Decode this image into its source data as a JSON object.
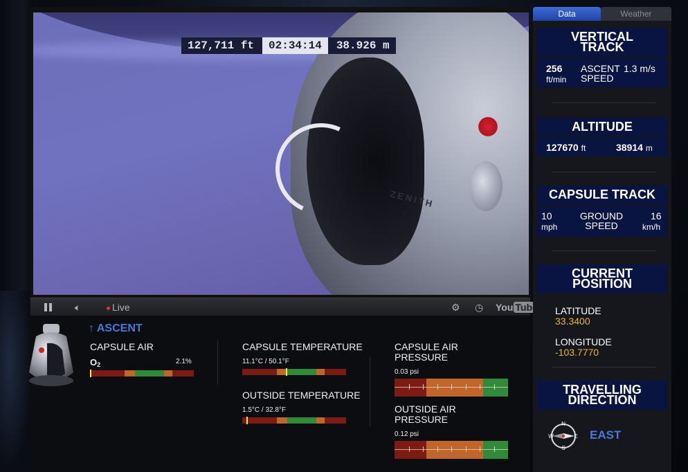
{
  "video": {
    "altitude_ft": "127,711 ft",
    "elapsed_time": "02:34:14",
    "altitude_m": "38.926 m",
    "capsule_text": "ZENITH"
  },
  "controls": {
    "live_label": "Live",
    "youtube_label": "You",
    "youtube_tube": "Tube"
  },
  "status": {
    "phase": "ASCENT",
    "arrow": "↑"
  },
  "capsule_air": {
    "title": "CAPSULE AIR",
    "gas": "O",
    "gas_sub": "2",
    "value": "2.1%",
    "level": 0.0
  },
  "capsule_temperature": {
    "title": "CAPSULE TEMPERATURE",
    "value": "11.1°C / 50.1°F",
    "level": 0.42
  },
  "outside_temperature": {
    "title": "OUTSIDE TEMPERATURE",
    "value": "1.5°C / 32.8°F",
    "level": 0.04
  },
  "capsule_air_pressure": {
    "title_line1": "CAPSULE AIR",
    "title_line2": "PRESSURE",
    "value": "0.03 psi"
  },
  "outside_air_pressure": {
    "title_line1": "OUTSIDE AIR",
    "title_line2": "PRESSURE",
    "value": "0.12 psi"
  },
  "tabs": {
    "data": "Data",
    "weather": "Weather"
  },
  "vertical_track": {
    "title_line1": "VERTICAL",
    "title_line2": "TRACK",
    "rate": "256",
    "rate_unit": "ft/min",
    "label_line1": "ASCENT",
    "label_line2": "SPEED",
    "speed": "1.3 m/s"
  },
  "altitude": {
    "title": "ALTITUDE",
    "ft": "127670",
    "ft_unit": "ft",
    "m": "38914",
    "m_unit": "m"
  },
  "capsule_track": {
    "title": "CAPSULE TRACK",
    "mph": "10",
    "mph_unit": "mph",
    "label_line1": "GROUND",
    "label_line2": "SPEED",
    "kmh": "16",
    "kmh_unit": "km/h"
  },
  "current_position": {
    "title_line1": "CURRENT",
    "title_line2": "POSITION",
    "latitude_label": "LATITUDE",
    "latitude": "33.3400",
    "longitude_label": "LONGITUDE",
    "longitude": "-103.7770"
  },
  "travelling_direction": {
    "title_line1": "TRAVELLING",
    "title_line2": "DIRECTION",
    "direction": "EAST",
    "compass": {
      "n": "N",
      "e": "E",
      "s": "S",
      "w": "W"
    }
  },
  "colors": {
    "accent_blue": "#3e6bd6",
    "panel_navy": "#0a1440",
    "gold": "#e7b635",
    "bar_red": "#7c1a14",
    "bar_orange": "#c0662a",
    "bar_green": "#2f8a3a"
  }
}
